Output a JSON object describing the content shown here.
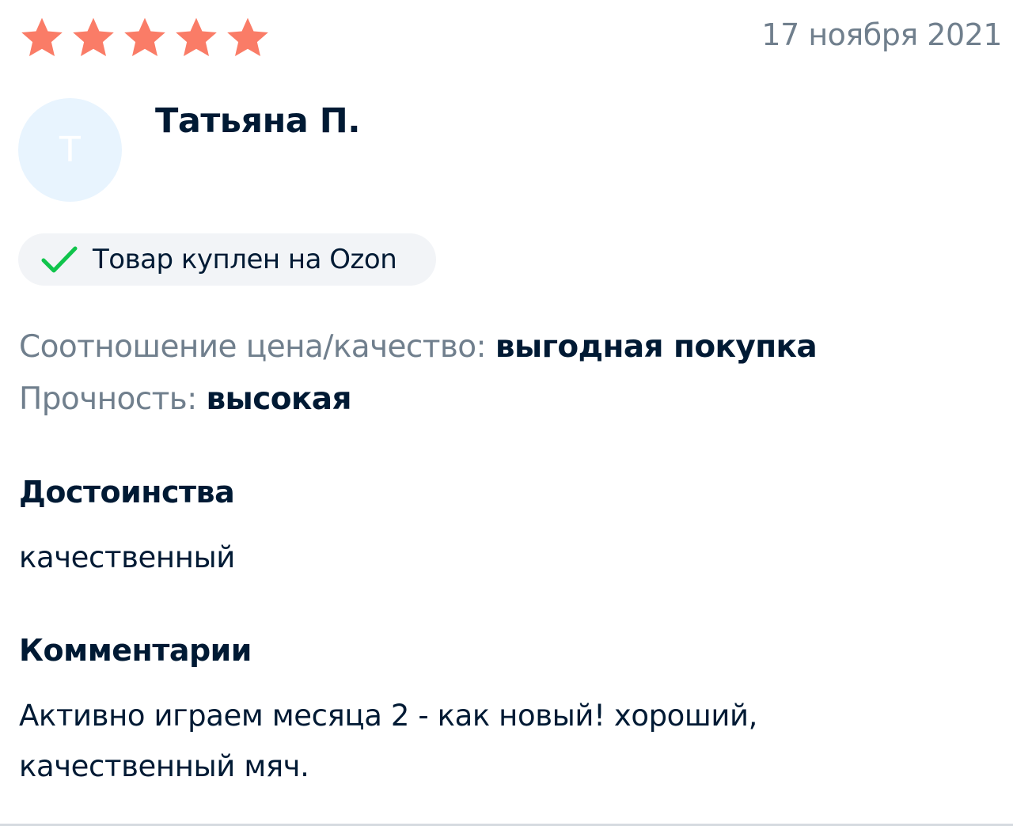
{
  "review": {
    "rating": 5,
    "rating_max": 5,
    "star_color": "#fa7c67",
    "date": "17 ноября 2021",
    "author": {
      "name": "Татьяна П.",
      "initial": "Т",
      "avatar_color": "#e8f4fe"
    },
    "badge": {
      "text": "Товар куплен на Ozon",
      "icon": "checkmark-icon",
      "icon_color": "#10c44c"
    },
    "properties": [
      {
        "label": "Соотношение цена/качество:",
        "value": "выгодная покупка"
      },
      {
        "label": "Прочность:",
        "value": "высокая"
      }
    ],
    "sections": [
      {
        "heading": "Достоинства",
        "text": "качественный"
      },
      {
        "heading": "Комментарии",
        "text": "Активно играем месяца 2 - как новый! хороший, качественный мяч."
      }
    ]
  }
}
